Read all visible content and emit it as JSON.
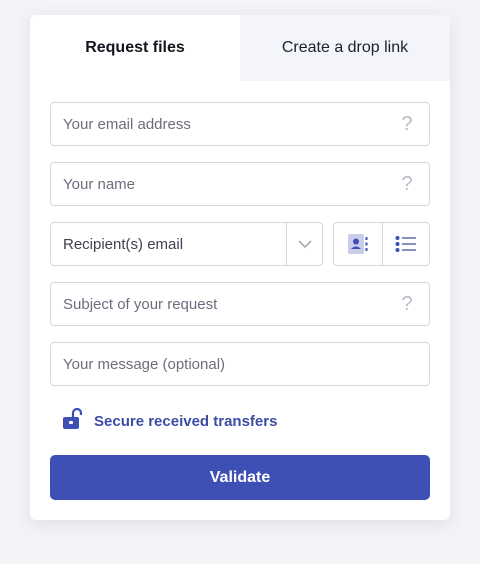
{
  "tabs": [
    {
      "label": "Request files",
      "active": true
    },
    {
      "label": "Create a drop link",
      "active": false
    }
  ],
  "form": {
    "email_placeholder": "Your email address",
    "name_placeholder": "Your name",
    "recipients_placeholder": "Recipient(s) email",
    "subject_placeholder": "Subject of your request",
    "message_placeholder": "Your message (optional)",
    "help_glyph": "?"
  },
  "secure_label": "Secure received transfers",
  "validate_label": "Validate",
  "colors": {
    "accent": "#3e4fb5",
    "link": "#3d4ca6",
    "border": "#d5d7de",
    "icon_muted": "#b8bbc4",
    "contact_icon_bg": "#c9cdea"
  },
  "icons": [
    "help-icon",
    "chevron-down-icon",
    "contact-book-icon",
    "list-icon",
    "unlocked-padlock-icon"
  ]
}
